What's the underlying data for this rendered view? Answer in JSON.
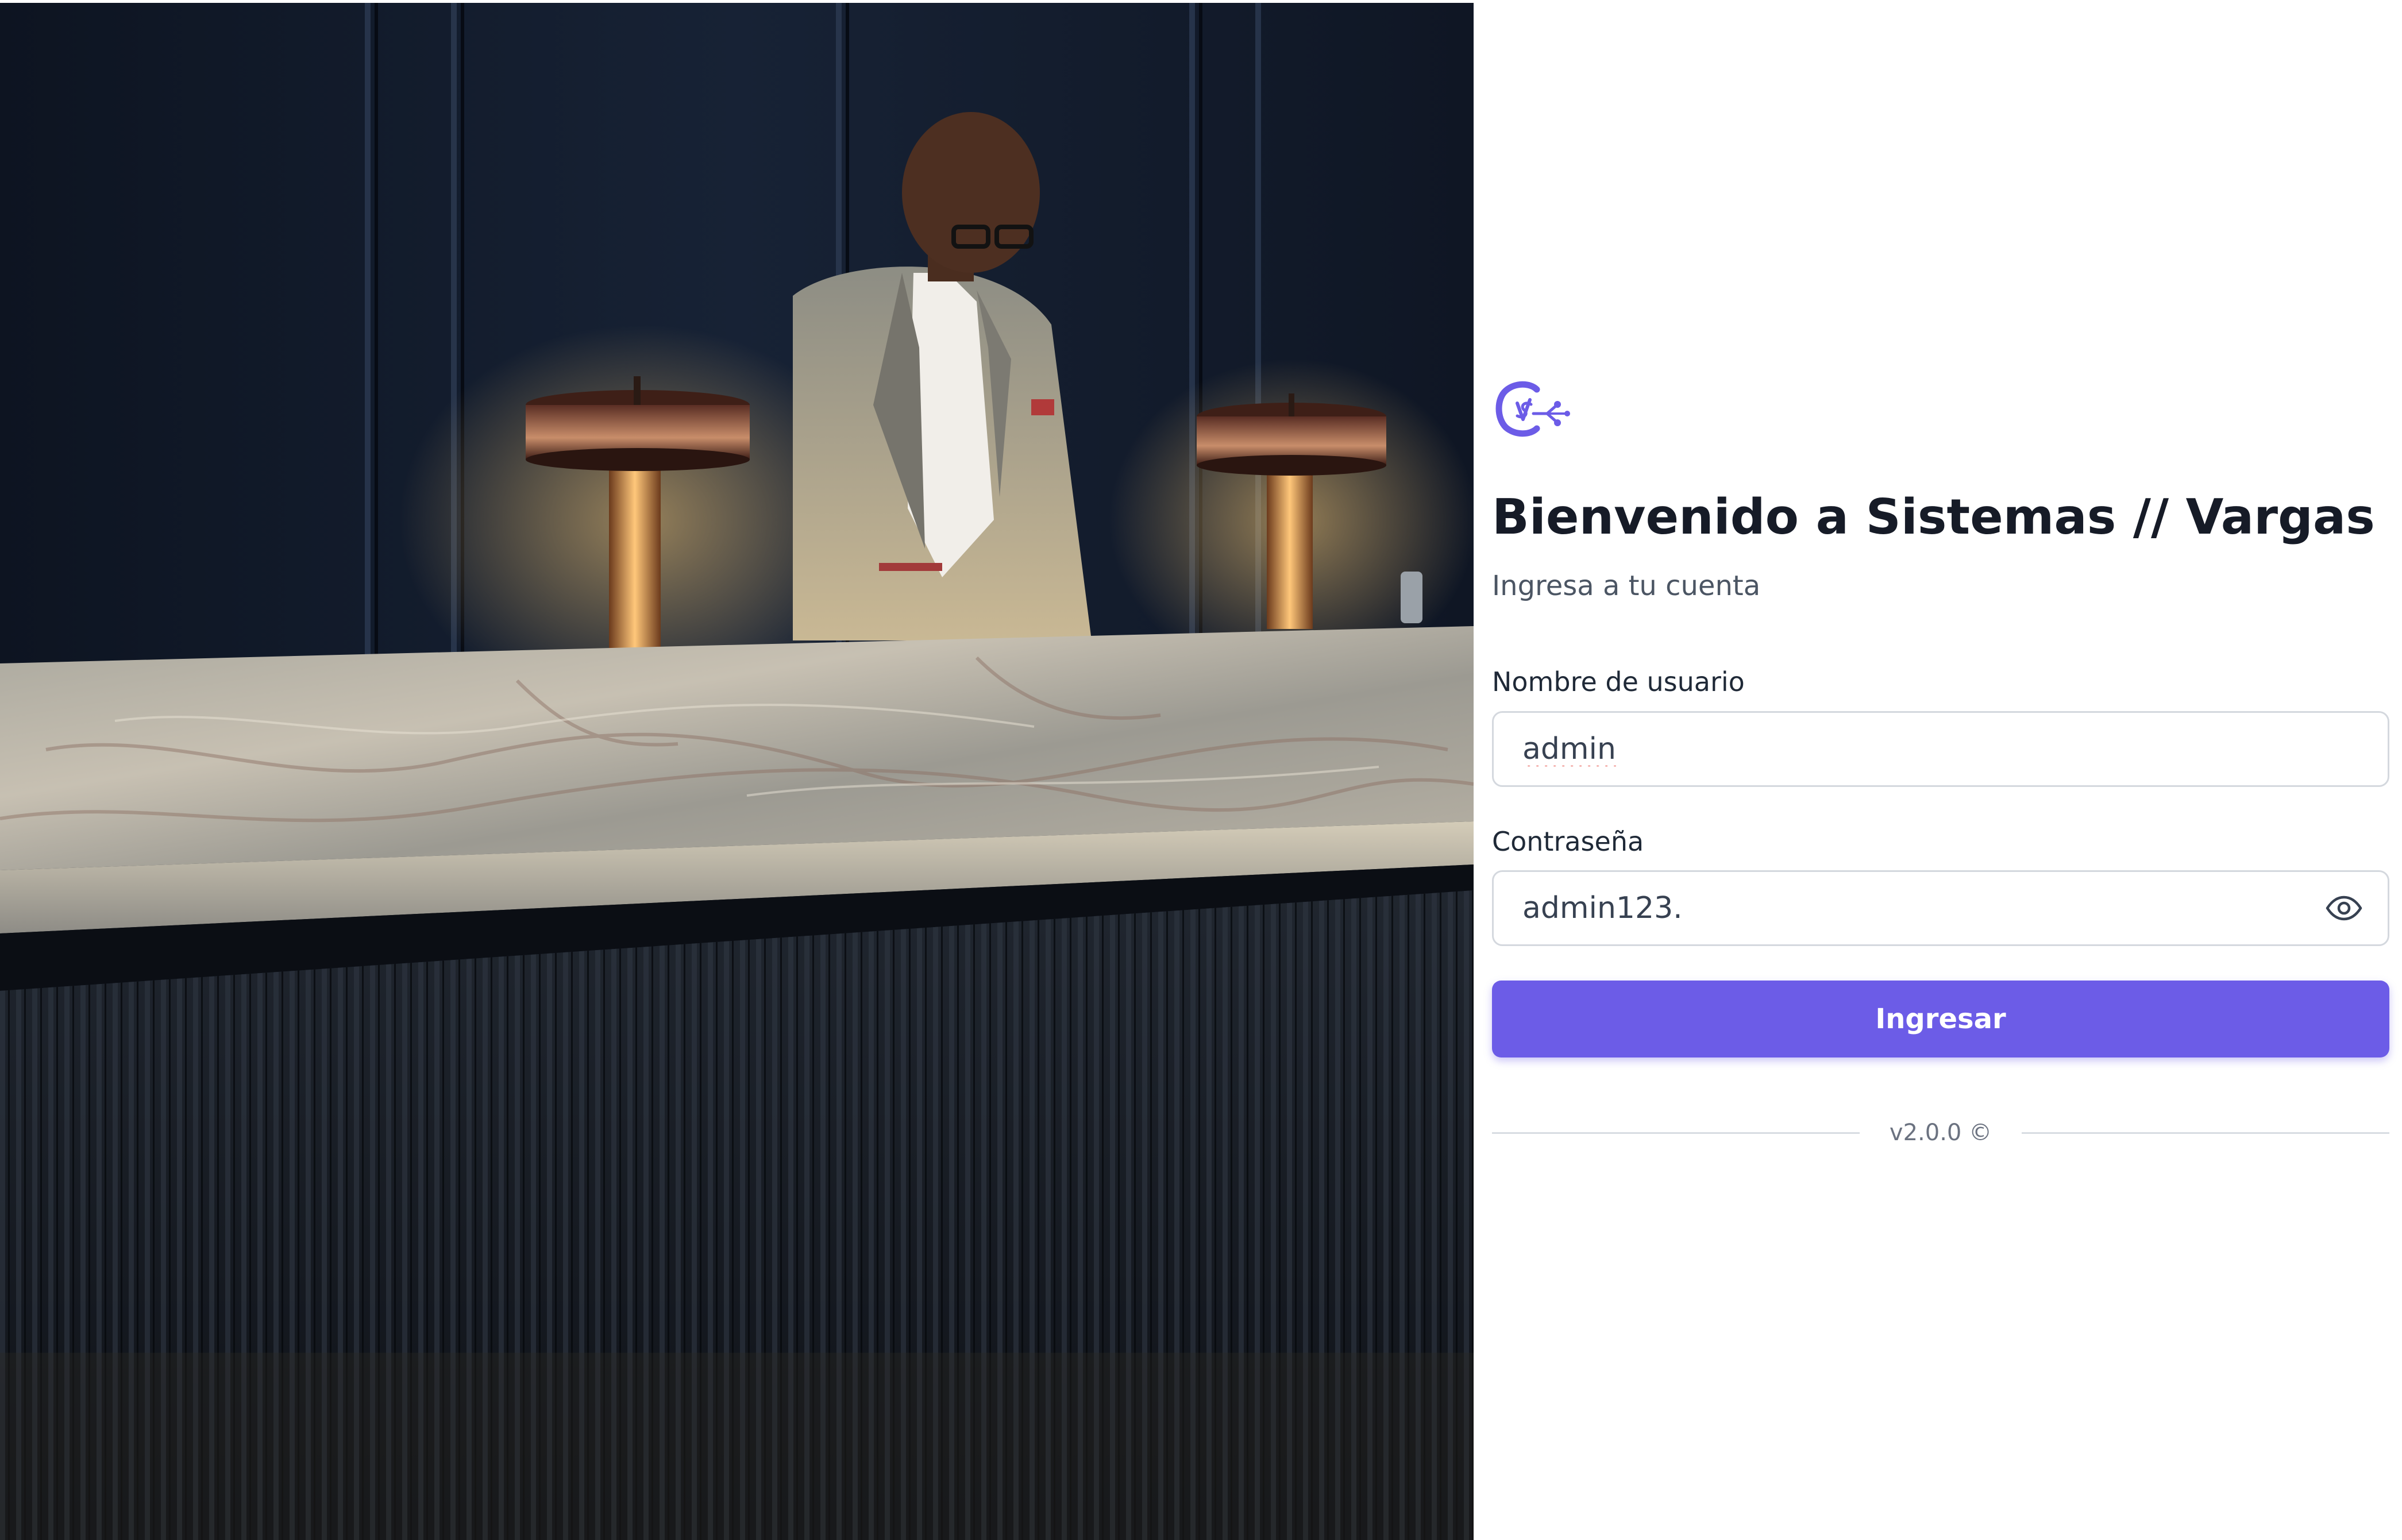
{
  "hero": {
    "image": "hotel-reception-photo"
  },
  "brand": {
    "logo_icon": "sv-monogram-logo-icon",
    "accent_color": "#6c5ce7"
  },
  "login": {
    "title": "Bienvenido a Sistemas // Vargas",
    "subtitle": "Ingresa a tu cuenta",
    "username": {
      "label": "Nombre de usuario",
      "value": "admin"
    },
    "password": {
      "label": "Contraseña",
      "value": "admin123.",
      "toggle_icon": "eye-icon"
    },
    "submit_label": "Ingresar"
  },
  "footer": {
    "version": "v2.0.0 ©"
  }
}
